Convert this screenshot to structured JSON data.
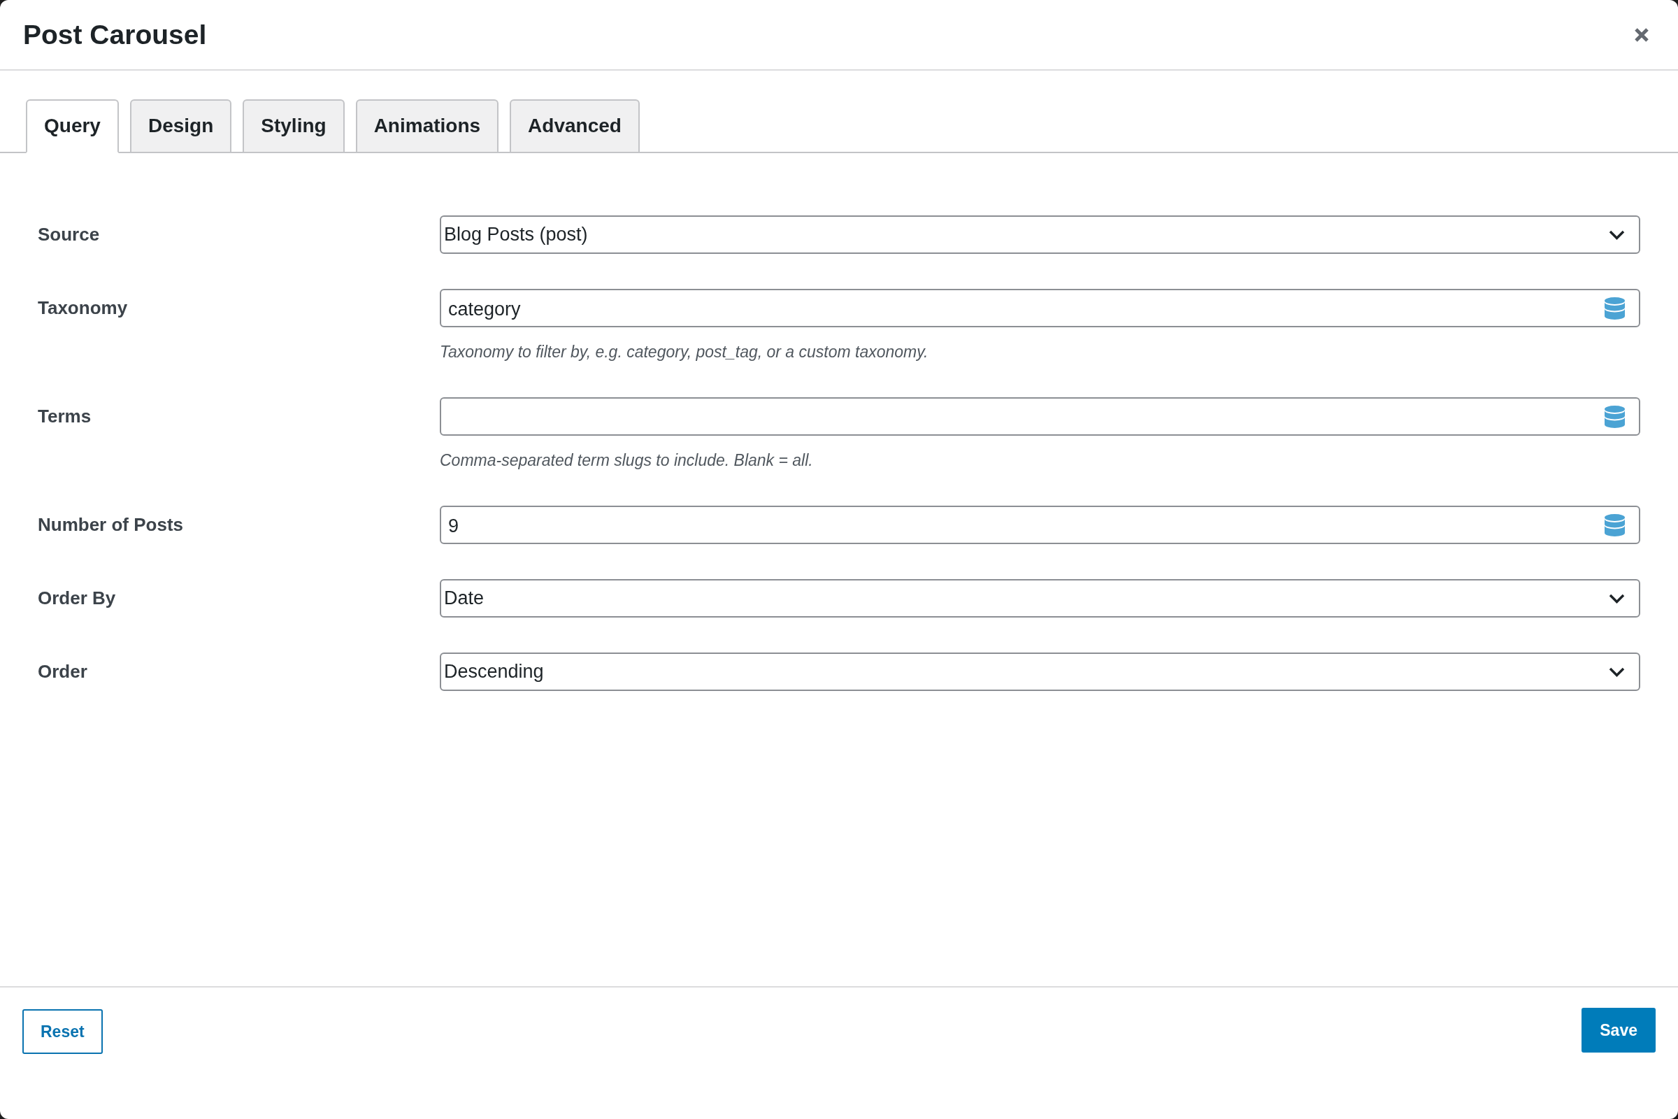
{
  "dialog": {
    "title": "Post Carousel"
  },
  "tabs": [
    {
      "label": "Query",
      "selected": true
    },
    {
      "label": "Design",
      "selected": false
    },
    {
      "label": "Styling",
      "selected": false
    },
    {
      "label": "Animations",
      "selected": false
    },
    {
      "label": "Advanced",
      "selected": false
    }
  ],
  "fields": [
    {
      "kind": "select",
      "label": "Source",
      "value": "Blog Posts (post)"
    },
    {
      "kind": "text",
      "label": "Taxonomy",
      "value": "category",
      "description": "Taxonomy to filter by, e.g. category, post_tag, or a custom taxonomy."
    },
    {
      "kind": "text",
      "label": "Terms",
      "description": "Comma-separated term slugs to include. Blank = all."
    },
    {
      "kind": "text",
      "label": "Number of Posts",
      "value": "9"
    },
    {
      "kind": "select",
      "label": "Order By",
      "value": "Date"
    },
    {
      "kind": "select",
      "label": "Order",
      "value": "Descending"
    }
  ],
  "footer": {
    "buttons": [
      {
        "kind": "secondary",
        "label": "Reset"
      },
      {
        "kind": "primary",
        "label": "Save"
      }
    ]
  }
}
